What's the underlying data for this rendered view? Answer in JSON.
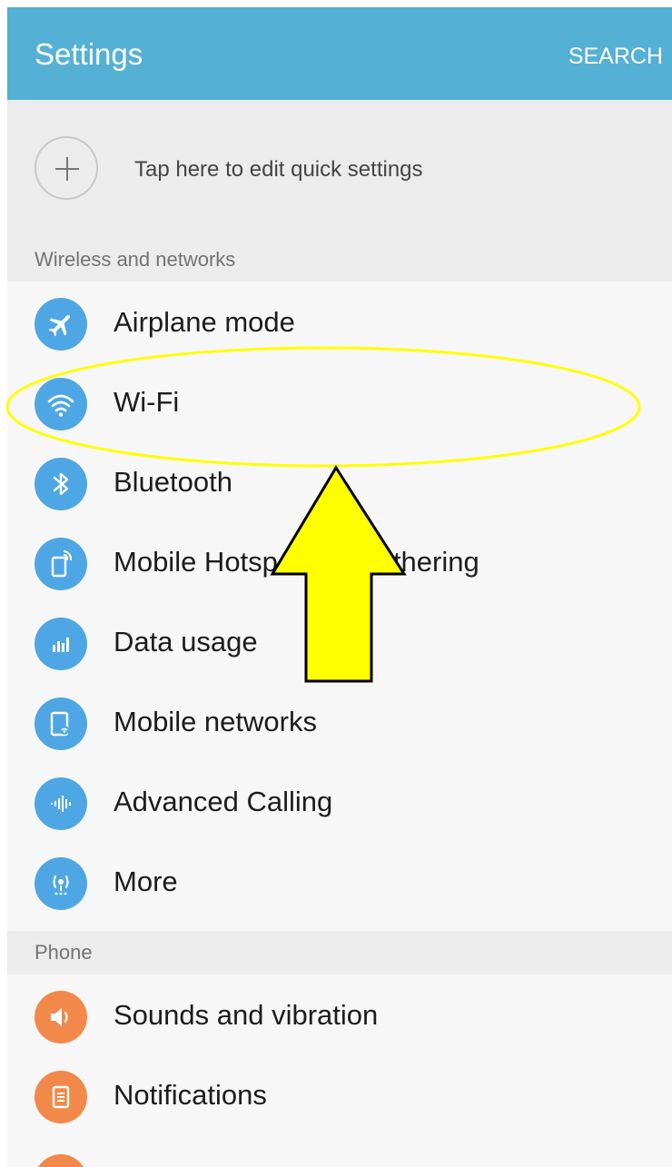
{
  "app_bar": {
    "title": "Settings",
    "search_label": "SEARCH"
  },
  "quick_settings": {
    "label": "Tap here to edit quick settings",
    "icon": "plus-icon"
  },
  "sections": [
    {
      "header": "Wireless and networks",
      "items": [
        {
          "label": "Airplane mode",
          "icon": "airplane-icon"
        },
        {
          "label": "Wi-Fi",
          "icon": "wifi-icon"
        },
        {
          "label": "Bluetooth",
          "icon": "bluetooth-icon"
        },
        {
          "label": "Mobile Hotspot and Tethering",
          "icon": "hotspot-icon"
        },
        {
          "label": "Data usage",
          "icon": "data-usage-icon"
        },
        {
          "label": "Mobile networks",
          "icon": "mobile-networks-icon"
        },
        {
          "label": "Advanced Calling",
          "icon": "advanced-calling-icon"
        },
        {
          "label": "More",
          "icon": "more-connections-icon"
        }
      ]
    },
    {
      "header": "Phone",
      "items": [
        {
          "label": "Sounds and vibration",
          "icon": "sound-icon"
        },
        {
          "label": "Notifications",
          "icon": "notifications-icon"
        }
      ]
    }
  ],
  "colors": {
    "app_bar": "#55b0d6",
    "blue_icon": "#4ea7e4",
    "orange_icon": "#f2894a",
    "annotation_highlight": "#ffff00"
  },
  "annotation": {
    "highlight_shape": "ellipse",
    "arrow_direction": "up"
  }
}
